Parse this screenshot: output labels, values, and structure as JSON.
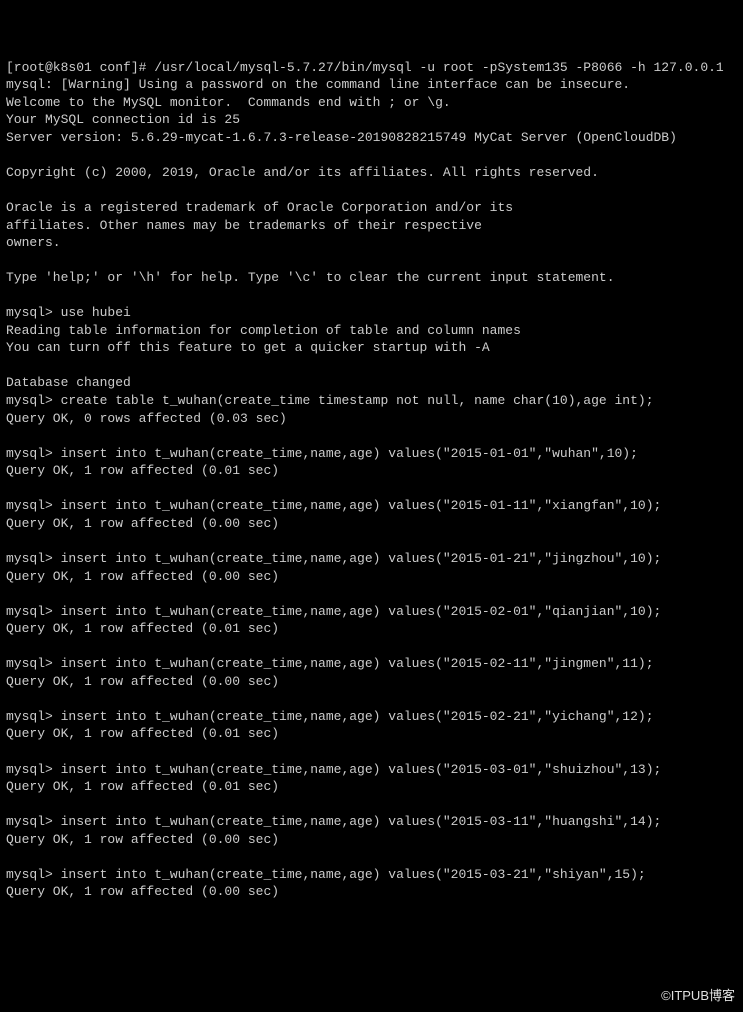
{
  "lines": [
    "[root@k8s01 conf]# /usr/local/mysql-5.7.27/bin/mysql -u root -pSystem135 -P8066 -h 127.0.0.1",
    "mysql: [Warning] Using a password on the command line interface can be insecure.",
    "Welcome to the MySQL monitor.  Commands end with ; or \\g.",
    "Your MySQL connection id is 25",
    "Server version: 5.6.29-mycat-1.6.7.3-release-20190828215749 MyCat Server (OpenCloudDB)",
    "",
    "Copyright (c) 2000, 2019, Oracle and/or its affiliates. All rights reserved.",
    "",
    "Oracle is a registered trademark of Oracle Corporation and/or its",
    "affiliates. Other names may be trademarks of their respective",
    "owners.",
    "",
    "Type 'help;' or '\\h' for help. Type '\\c' to clear the current input statement.",
    "",
    "mysql> use hubei",
    "Reading table information for completion of table and column names",
    "You can turn off this feature to get a quicker startup with -A",
    "",
    "Database changed",
    "mysql> create table t_wuhan(create_time timestamp not null, name char(10),age int);",
    "Query OK, 0 rows affected (0.03 sec)",
    "",
    "mysql> insert into t_wuhan(create_time,name,age) values(\"2015-01-01\",\"wuhan\",10);",
    "Query OK, 1 row affected (0.01 sec)",
    "",
    "mysql> insert into t_wuhan(create_time,name,age) values(\"2015-01-11\",\"xiangfan\",10);",
    "Query OK, 1 row affected (0.00 sec)",
    "",
    "mysql> insert into t_wuhan(create_time,name,age) values(\"2015-01-21\",\"jingzhou\",10);",
    "Query OK, 1 row affected (0.00 sec)",
    "",
    "mysql> insert into t_wuhan(create_time,name,age) values(\"2015-02-01\",\"qianjian\",10);",
    "Query OK, 1 row affected (0.01 sec)",
    "",
    "mysql> insert into t_wuhan(create_time,name,age) values(\"2015-02-11\",\"jingmen\",11);",
    "Query OK, 1 row affected (0.00 sec)",
    "",
    "mysql> insert into t_wuhan(create_time,name,age) values(\"2015-02-21\",\"yichang\",12);",
    "Query OK, 1 row affected (0.01 sec)",
    "",
    "mysql> insert into t_wuhan(create_time,name,age) values(\"2015-03-01\",\"shuizhou\",13);",
    "Query OK, 1 row affected (0.01 sec)",
    "",
    "mysql> insert into t_wuhan(create_time,name,age) values(\"2015-03-11\",\"huangshi\",14);",
    "Query OK, 1 row affected (0.00 sec)",
    "",
    "mysql> insert into t_wuhan(create_time,name,age) values(\"2015-03-21\",\"shiyan\",15);",
    "Query OK, 1 row affected (0.00 sec)",
    ""
  ],
  "watermark": "©ITPUB博客"
}
